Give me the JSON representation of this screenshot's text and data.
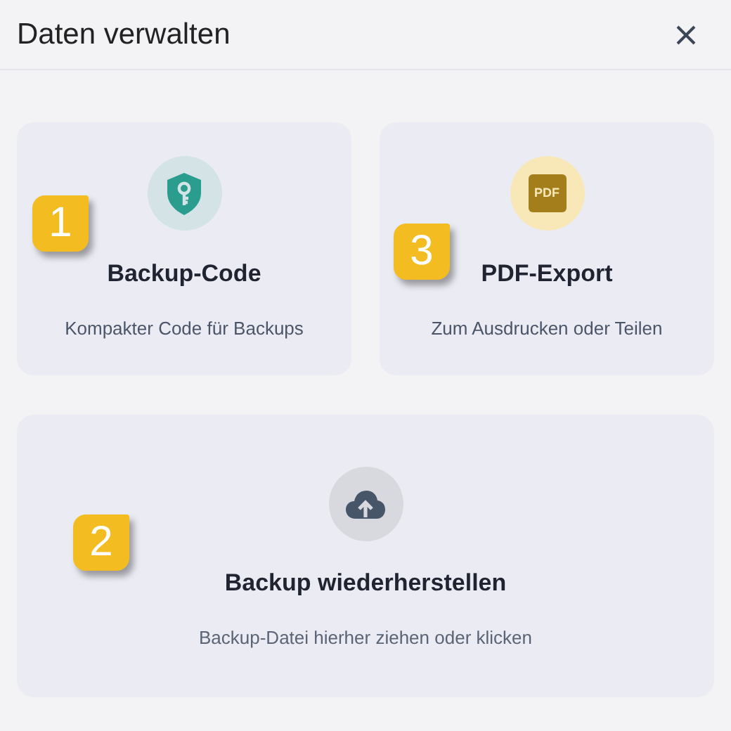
{
  "dialog": {
    "title": "Daten verwalten"
  },
  "cards": [
    {
      "kind": "backup-code",
      "title": "Backup-Code",
      "subtitle": "Kompakter Code für Backups",
      "badge": "1"
    },
    {
      "kind": "pdf",
      "title": "PDF-Export",
      "subtitle": "Zum Ausdrucken oder Teilen",
      "icon_text": "PDF",
      "badge": "3"
    }
  ],
  "restore": {
    "title": "Backup wiederherstellen",
    "subtitle": "Backup-Datei hierher ziehen oder klicken",
    "badge": "2"
  }
}
